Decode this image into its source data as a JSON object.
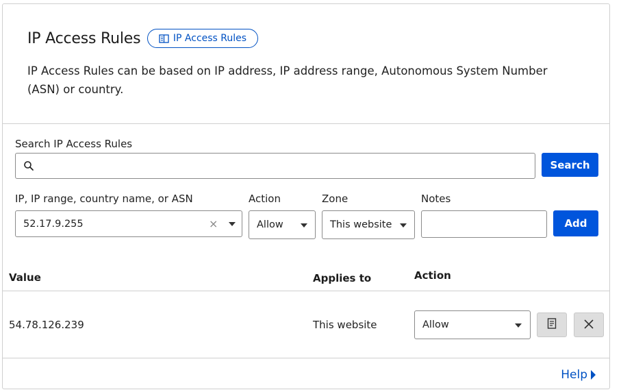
{
  "header": {
    "title": "IP Access Rules",
    "doc_link_label": "IP Access Rules",
    "description": "IP Access Rules can be based on IP address, IP address range, Autonomous System Number (ASN) or country."
  },
  "search": {
    "label": "Search IP Access Rules",
    "value": "",
    "button_label": "Search"
  },
  "add_form": {
    "ip_label": "IP, IP range, country name, or ASN",
    "ip_value": "52.17.9.255",
    "action_label": "Action",
    "action_value": "Allow",
    "zone_label": "Zone",
    "zone_value": "This website",
    "notes_label": "Notes",
    "notes_value": "",
    "add_button_label": "Add"
  },
  "table": {
    "columns": [
      "Value",
      "Applies to",
      "Action"
    ],
    "rows": [
      {
        "value": "54.78.126.239",
        "applies_to": "This website",
        "action": "Allow"
      }
    ]
  },
  "footer": {
    "help_label": "Help"
  },
  "colors": {
    "accent": "#0055dc",
    "link": "#0051c3",
    "border": "#cfcfcf"
  }
}
